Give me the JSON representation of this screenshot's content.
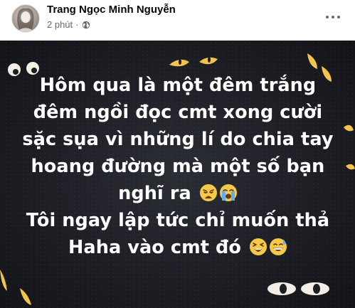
{
  "post": {
    "author": "Trang Ngọc Minh Nguyễn",
    "time": "2 phút",
    "separator": "·",
    "privacy_icon": "globe-icon",
    "more_icon": "more-options-icon"
  },
  "image": {
    "background_color": "#1e1f25",
    "eye_color": "#f2c44b",
    "text_color": "#ffffff",
    "lines": [
      "Hôm qua là một đêm trắng",
      "đêm ngồi đọc cmt xong cười",
      "sặc sụa vì những lí do chia tay",
      "hoang đường mà một số bạn",
      "nghĩ ra",
      "Tôi ngay lập tức chỉ muốn thả",
      "Haha vào cmt đó"
    ],
    "emojis": {
      "line5": [
        "weary-face-emoji",
        "loudly-crying-face-emoji"
      ],
      "line7": [
        "squinting-face-emoji",
        "grinning-sweat-emoji"
      ]
    }
  }
}
